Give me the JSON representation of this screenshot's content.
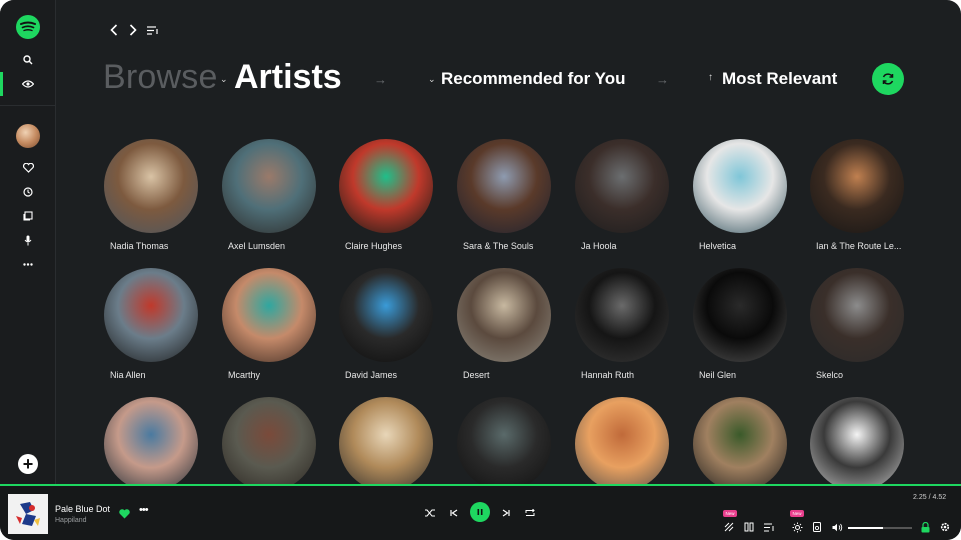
{
  "header": {
    "browse": "Browse",
    "section": "Artists",
    "filter_recommended": "Recommended for You",
    "filter_sort": "Most Relevant"
  },
  "artists": [
    {
      "name": "Nadia Thomas",
      "colors": [
        "#d9c3a5",
        "#7d5a3f",
        "#4a5560"
      ]
    },
    {
      "name": "Axel Lumsden",
      "colors": [
        "#9a7a6a",
        "#4f6f78",
        "#2c2a28"
      ]
    },
    {
      "name": "Claire Hughes",
      "colors": [
        "#1fbf8a",
        "#c0392b",
        "#0e1a16"
      ]
    },
    {
      "name": "Sara & The Souls",
      "colors": [
        "#8e9bb0",
        "#5a3a2a",
        "#1e2230"
      ]
    },
    {
      "name": "Ja Hoola",
      "colors": [
        "#6b6e70",
        "#3b2e2a",
        "#1b1c1d"
      ]
    },
    {
      "name": "Helvetica",
      "colors": [
        "#7fc6d8",
        "#e6e6e6",
        "#2f4f5a"
      ]
    },
    {
      "name": "Ian & The Route Le...",
      "colors": [
        "#c08050",
        "#3a2a20",
        "#151515"
      ]
    },
    {
      "name": "Nia Allen",
      "colors": [
        "#c0392b",
        "#6b7d8a",
        "#1a1a1a"
      ]
    },
    {
      "name": "Mcarthy",
      "colors": [
        "#2fa7a0",
        "#c58a6a",
        "#3b2a22"
      ]
    },
    {
      "name": "David James",
      "colors": [
        "#3a9bd8",
        "#2a2a2a",
        "#0c0c0c"
      ]
    },
    {
      "name": "Desert",
      "colors": [
        "#c7b8a0",
        "#5b4a3e",
        "#8e8a80"
      ]
    },
    {
      "name": "Hannah Ruth",
      "colors": [
        "#6a6a6a",
        "#151515",
        "#3a3a3a"
      ]
    },
    {
      "name": "Neil Glen",
      "colors": [
        "#2a2a2a",
        "#0a0a0a",
        "#555555"
      ]
    },
    {
      "name": "Skelco",
      "colors": [
        "#8c8c8c",
        "#3a2f2a",
        "#2a2a2a"
      ]
    },
    {
      "name": "",
      "colors": [
        "#4a7aa0",
        "#c59a8a",
        "#1e2a34"
      ]
    },
    {
      "name": "",
      "colors": [
        "#7a4a3a",
        "#5a5a50",
        "#2a2520"
      ]
    },
    {
      "name": "",
      "colors": [
        "#e8d6b8",
        "#b08a5a",
        "#2a2a2a"
      ]
    },
    {
      "name": "",
      "colors": [
        "#5a6a6a",
        "#2a2a2a",
        "#0f0f0f"
      ]
    },
    {
      "name": "",
      "colors": [
        "#c06a3a",
        "#e8a060",
        "#4a4a4a"
      ]
    },
    {
      "name": "",
      "colors": [
        "#3a5a2a",
        "#a08060",
        "#1a1a1a"
      ]
    },
    {
      "name": "",
      "colors": [
        "#f4f4f4",
        "#3a3a3a",
        "#c8c8c8"
      ]
    }
  ],
  "player": {
    "track_title": "Pale Blue Dot",
    "track_artist": "Happiland",
    "time_current": "2.25",
    "time_separator": "/",
    "time_total": "4.52",
    "volume": 0.55,
    "new_badge_1": "New",
    "new_badge_2": "New"
  },
  "colors": {
    "accent": "#1ed760",
    "background": "#1c1f21",
    "badge": "#e83e8c"
  },
  "icons": {
    "logo": "spotify-logo",
    "search": "search-icon",
    "browse": "eye-icon",
    "liked": "heart-icon",
    "recent": "history-icon",
    "library": "library-icon",
    "podcasts": "microphone-icon",
    "more": "more-icon",
    "add": "plus-icon"
  }
}
